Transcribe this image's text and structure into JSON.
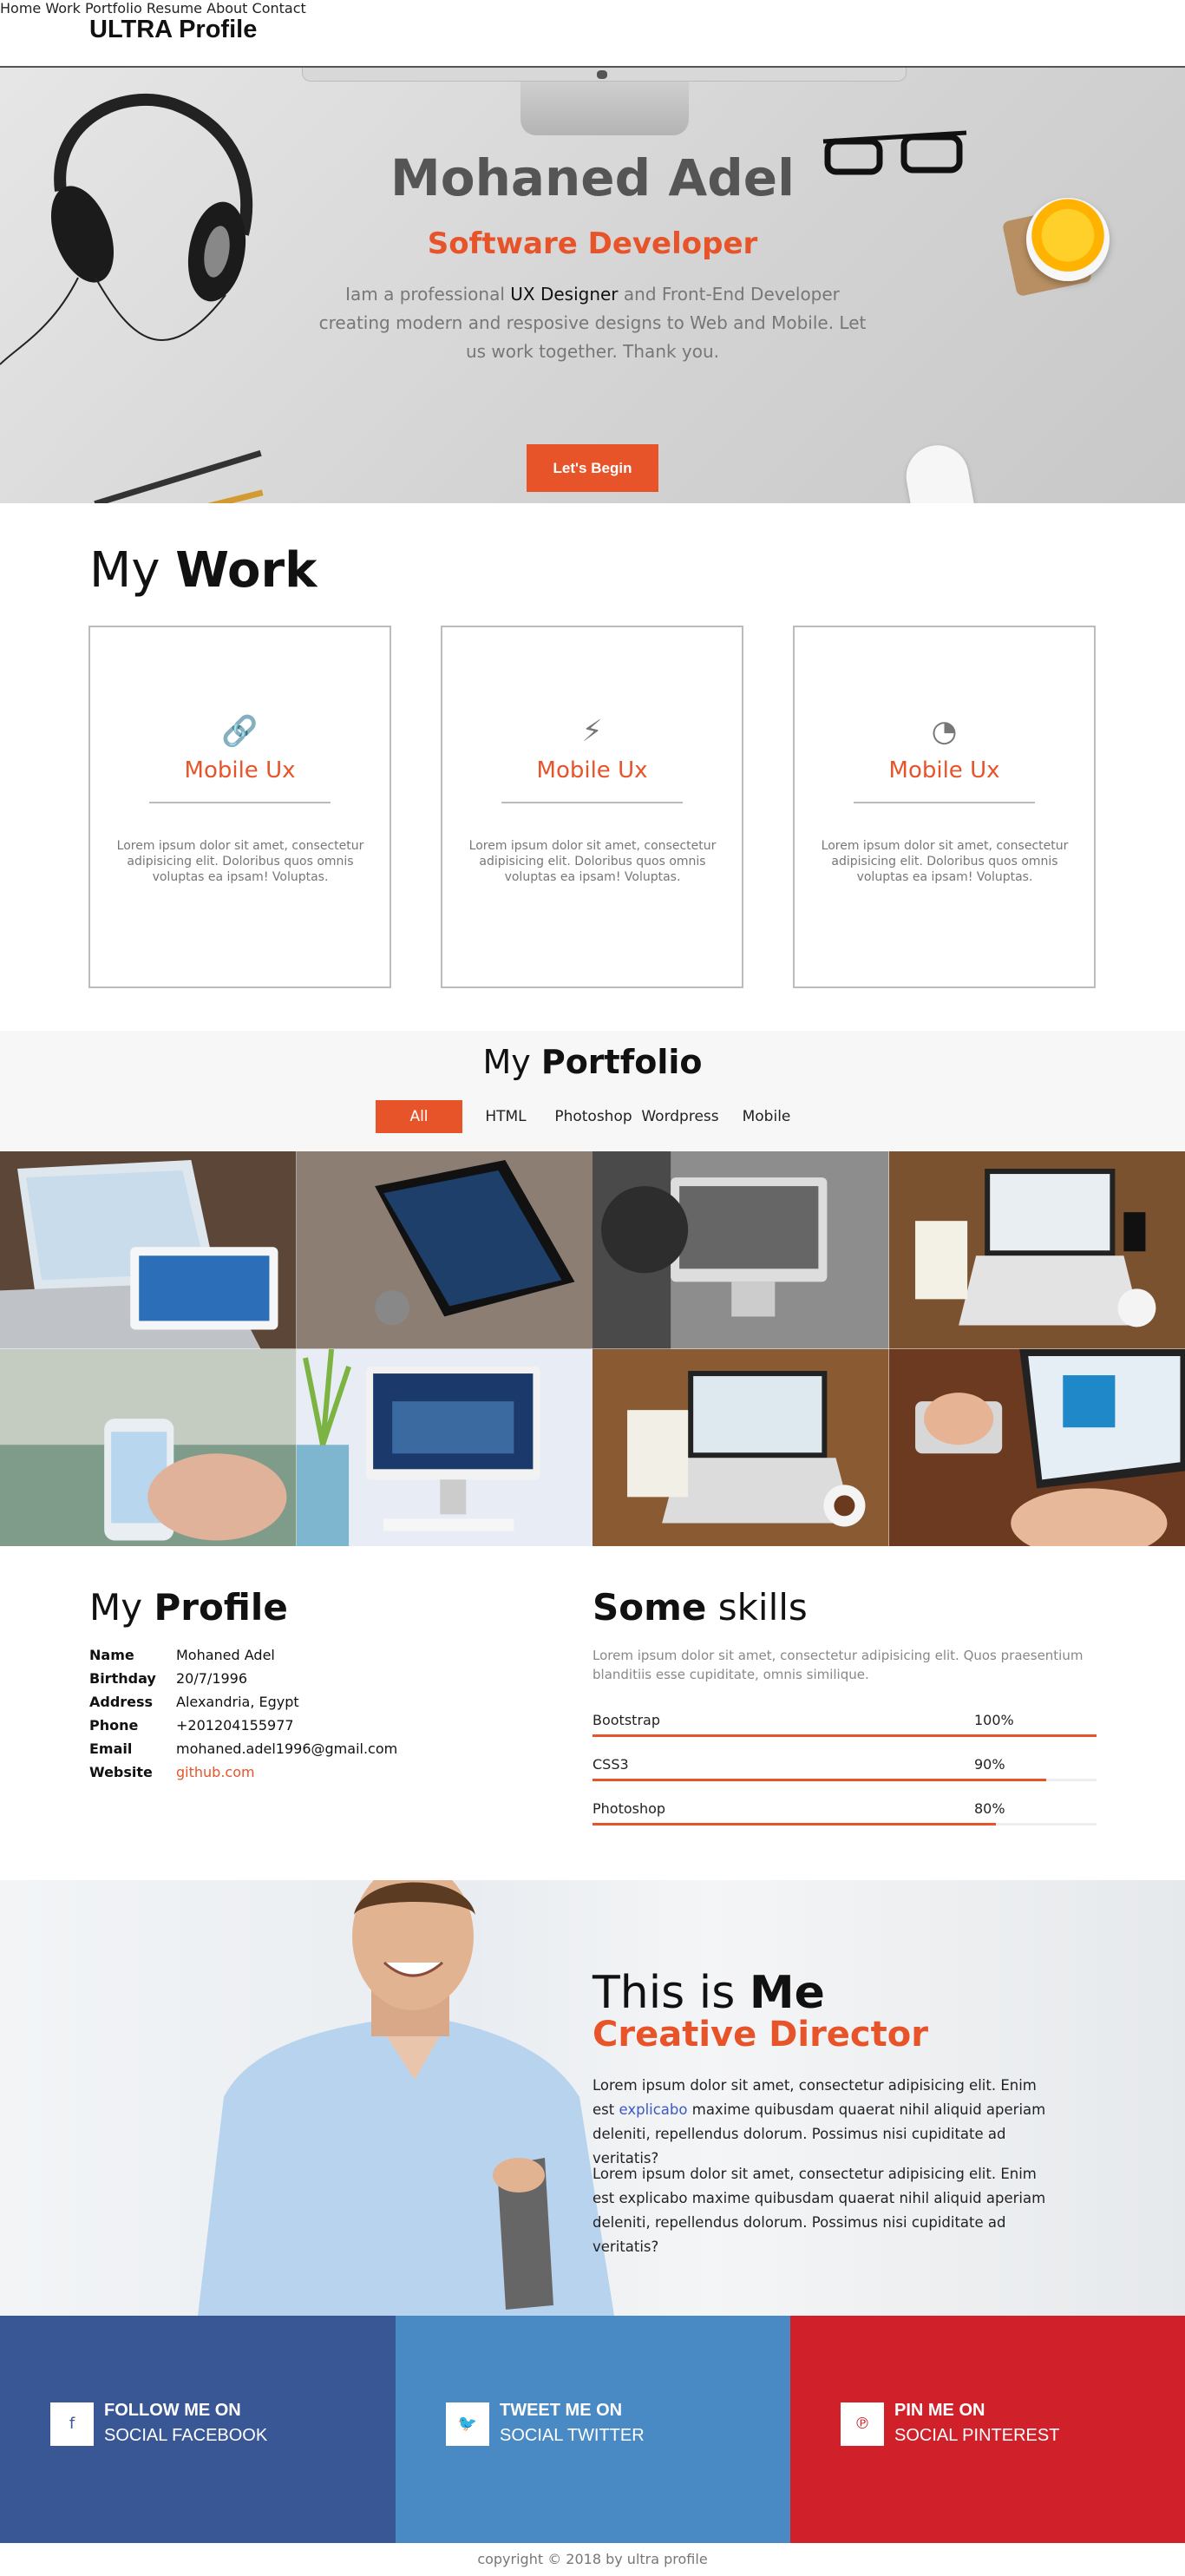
{
  "nav": {
    "brand": "ULTRA Profile",
    "items": [
      "Home",
      "Work",
      "Portfolio",
      "Resume",
      "About",
      "Contact"
    ]
  },
  "hero": {
    "name": "Mohaned Adel",
    "role": "Software Developer",
    "text_before": "Iam a professional ",
    "text_em": "UX Designer",
    "text_after": " and Front-End Developer creating modern and resposive designs to Web and Mobile. Let us work together. Thank you.",
    "button": "Let's Begin"
  },
  "work": {
    "title_light": "My ",
    "title_bold": "Work",
    "cards": [
      {
        "icon": "link-icon",
        "glyph": "🔗",
        "title": "Mobile Ux",
        "desc": "Lorem ipsum dolor sit amet, consectetur adipisicing elit. Doloribus quos omnis voluptas ea ipsam! Voluptas."
      },
      {
        "icon": "bolt-icon",
        "glyph": "⚡",
        "title": "Mobile Ux",
        "desc": "Lorem ipsum dolor sit amet, consectetur adipisicing elit. Doloribus quos omnis voluptas ea ipsam! Voluptas."
      },
      {
        "icon": "gauge-icon",
        "glyph": "◔",
        "title": "Mobile Ux",
        "desc": "Lorem ipsum dolor sit amet, consectetur adipisicing elit. Doloribus quos omnis voluptas ea ipsam! Voluptas."
      }
    ]
  },
  "portfolio": {
    "title_light": "My ",
    "title_bold": "Portfolio",
    "filters": [
      "All",
      "HTML",
      "Photoshop",
      "Wordpress",
      "Mobile"
    ],
    "active_filter": "All"
  },
  "profile": {
    "title_light": "My ",
    "title_bold": "Profile",
    "rows": [
      {
        "k": "Name",
        "v": "Mohaned Adel"
      },
      {
        "k": "Birthday",
        "v": "20/7/1996"
      },
      {
        "k": "Address",
        "v": "Alexandria, Egypt"
      },
      {
        "k": "Phone",
        "v": "+201204155977"
      },
      {
        "k": "Email",
        "v": "mohaned.adel1996@gmail.com"
      },
      {
        "k": "Website",
        "v": "github.com"
      }
    ]
  },
  "skills": {
    "title_bold": "Some",
    "title_light": " skills",
    "desc": "Lorem ipsum dolor sit amet, consectetur adipisicing elit. Quos praesentium blanditiis esse cupiditate, omnis similique.",
    "items": [
      {
        "name": "Bootstrap",
        "percent": "100%",
        "value": 1.0
      },
      {
        "name": "CSS3",
        "percent": "90%",
        "value": 0.9
      },
      {
        "name": "Photoshop",
        "percent": "80%",
        "value": 0.8
      }
    ]
  },
  "about": {
    "title_light": "This is ",
    "title_bold": "Me",
    "role": "Creative Director",
    "p1_before": "Lorem ipsum dolor sit amet, consectetur adipisicing elit. Enim est ",
    "p1_link": "explicabo",
    "p1_after": " maxime quibusdam quaerat nihil aliquid aperiam deleniti, repellendus dolorum. Possimus nisi cupiditate ad veritatis?",
    "p2": "Lorem ipsum dolor sit amet, consectetur adipisicing elit. Enim est explicabo maxime quibusdam quaerat nihil aliquid aperiam deleniti, repellendus dolorum. Possimus nisi cupiditate ad veritatis?"
  },
  "social": [
    {
      "icon": "facebook-icon",
      "glyph": "f",
      "line1": "FOLLOW ME ON",
      "line2": "SOCIAL FACEBOOK",
      "color": "#3a5795"
    },
    {
      "icon": "twitter-icon",
      "glyph": "🐦",
      "line1": "TWEET ME ON",
      "line2": "SOCIAL TWITTER",
      "color": "#4a8ac4"
    },
    {
      "icon": "pinterest-icon",
      "glyph": "℗",
      "line1": "PIN ME ON",
      "line2": "SOCIAL PINTEREST",
      "color": "#d0202a"
    }
  ],
  "footer": "copyright © 2018 by ultra profile",
  "colors": {
    "accent": "#e8542a"
  }
}
